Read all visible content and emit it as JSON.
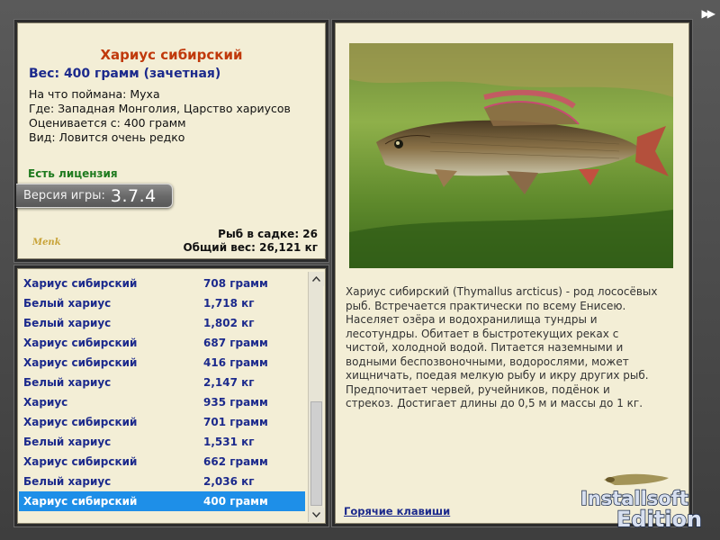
{
  "fish": {
    "title": "Хариус сибирский",
    "weight_line": "Вес: 400 грамм (зачетная)",
    "caught_on": "На что поймана: Муха",
    "where": "Где: Западная Монголия, Царство хариусов",
    "evaluated_from": "Оценивается с: 400 грамм",
    "rarity": "Вид: Ловится очень редко",
    "license": "Есть лицензия"
  },
  "version": {
    "label": "Версия игры:",
    "number": "3.7.4"
  },
  "logo_text": "Menk",
  "keepnet": {
    "count_line": "Рыб в садке: 26",
    "total_line": "Общий вес: 26,121 кг"
  },
  "catch_list": [
    {
      "name": "Хариус сибирский",
      "weight": "708 грамм"
    },
    {
      "name": "Белый хариус",
      "weight": "1,718 кг"
    },
    {
      "name": "Белый хариус",
      "weight": "1,802 кг"
    },
    {
      "name": "Хариус сибирский",
      "weight": "687 грамм"
    },
    {
      "name": "Хариус сибирский",
      "weight": "416 грамм"
    },
    {
      "name": "Белый хариус",
      "weight": "2,147 кг"
    },
    {
      "name": "Хариус",
      "weight": "935 грамм"
    },
    {
      "name": "Хариус сибирский",
      "weight": "701 грамм"
    },
    {
      "name": "Белый хариус",
      "weight": "1,531 кг"
    },
    {
      "name": "Хариус сибирский",
      "weight": "662 грамм"
    },
    {
      "name": "Белый хариус",
      "weight": "2,036 кг"
    },
    {
      "name": "Хариус сибирский",
      "weight": "400 грамм"
    }
  ],
  "selected_index": 11,
  "description_lines": [
    "Хариус сибирский (Thymallus arcticus) - род лососёвых",
    "рыб. Встречается практически по всему Енисею.",
    "Населяет озёра и водохранилища тундры и",
    "лесотундры. Обитает в быстротекущих реках с",
    "чистой, холодной водой. Питается наземными и",
    "водными беспозвоночными, водорослями, может",
    "хищничать, поедая мелкую рыбу и икру других рыб.",
    "Предпочитает червей, ручейников, подёнок и",
    "стрекоз. Достигает длины до 0,5 м и массы до 1 кг."
  ],
  "hotkeys_link": "Горячие клавиши",
  "top_button_glyph": "▶▶",
  "watermark": {
    "line1": "Installsoft",
    "line2": "Edition"
  },
  "colors": {
    "panel_bg": "#f3eed6",
    "title": "#c0390b",
    "list_text": "#1c2a8c",
    "selection": "#1e8fe8",
    "license": "#1e7a1e"
  }
}
